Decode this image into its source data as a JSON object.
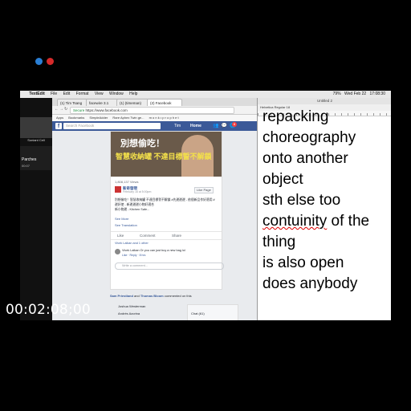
{
  "menubar": {
    "app": "TextEdit",
    "items": [
      "File",
      "Edit",
      "Format",
      "View",
      "Window",
      "Help"
    ],
    "status": [
      "79%",
      "Wed Feb 22",
      "17:08:30"
    ]
  },
  "call": {
    "video_label": "Soniant Cell",
    "caller": "Parches",
    "duration": "00:07"
  },
  "browser": {
    "tabs": [
      "(1) Tim Tsang",
      "facewire 3.1",
      "(1) (timeman)",
      "(2) Facebook"
    ],
    "url_secure": "Secure",
    "url": "https://www.facebook.com",
    "bookmarks": [
      "Apps",
      "Bookmarks",
      "SimpleAdder",
      "Rare Aphex Twin ge...",
      "m o n k • p r o p h e t"
    ]
  },
  "facebook": {
    "search_placeholder": "Search Facebook",
    "user": "Tim",
    "home": "Home",
    "badge": "8",
    "post": {
      "caption1": "別想偷吃！",
      "caption2": "智慧收納罐 不達目標誓不解鎖",
      "views": "1,808,137 Views",
      "page_name": "新奇發現",
      "date": "February 16 at 5:00pm",
      "like_page": "Like Page",
      "text": "別想偷吃！智慧收納罐 不達目標誓不解鎖 #先邊邊邊 - 依個新品作好適用 #邊好使 - 新邊邊邊小物好適合",
      "shop": "新小物邊 - Kitchen Safe...",
      "see_more": "See More",
      "see_translation": "See Translation",
      "actions": [
        "Like",
        "Comment",
        "Share"
      ],
      "likers": "Vivek Lalkan and 1 other",
      "comment": "Vivek Lalkan Or you can just buy a new bag lol",
      "comment_meta": "Like · Reply · 8 hrs",
      "write_comment": "Write a comment..."
    },
    "next": {
      "who1": "Sam Priestland",
      "who_and": "and",
      "who2": "Thomas Bloom",
      "suffix": "commented on this"
    },
    "chat_contacts": [
      "Joshua Westerman",
      "Andrés Azorina"
    ],
    "chat_label": "Chat (61)"
  },
  "textedit": {
    "title": "Untitled 2",
    "toolbar": "Helvetica   Regular   18",
    "lines": [
      {
        "text": "repacking",
        "spell": false
      },
      {
        "text": "choreography",
        "spell": false
      },
      {
        "text": "onto another",
        "spell": false
      },
      {
        "text": "object",
        "spell": false
      },
      {
        "text": "sth else too",
        "spell": false
      },
      {
        "text": "contuinity",
        "spell": true,
        "rest": " of the"
      },
      {
        "text": "thing",
        "spell": false
      },
      {
        "text": "is also open",
        "spell": false
      },
      {
        "text": "does anybody",
        "spell": false
      }
    ]
  },
  "timecode": "00:02:08;00",
  "colors": {
    "facebook_blue": "#3b5998",
    "link": "#365899",
    "spell_underline": "#dd0000",
    "decline": "#d62a2a",
    "accept": "#2a7fd5"
  }
}
